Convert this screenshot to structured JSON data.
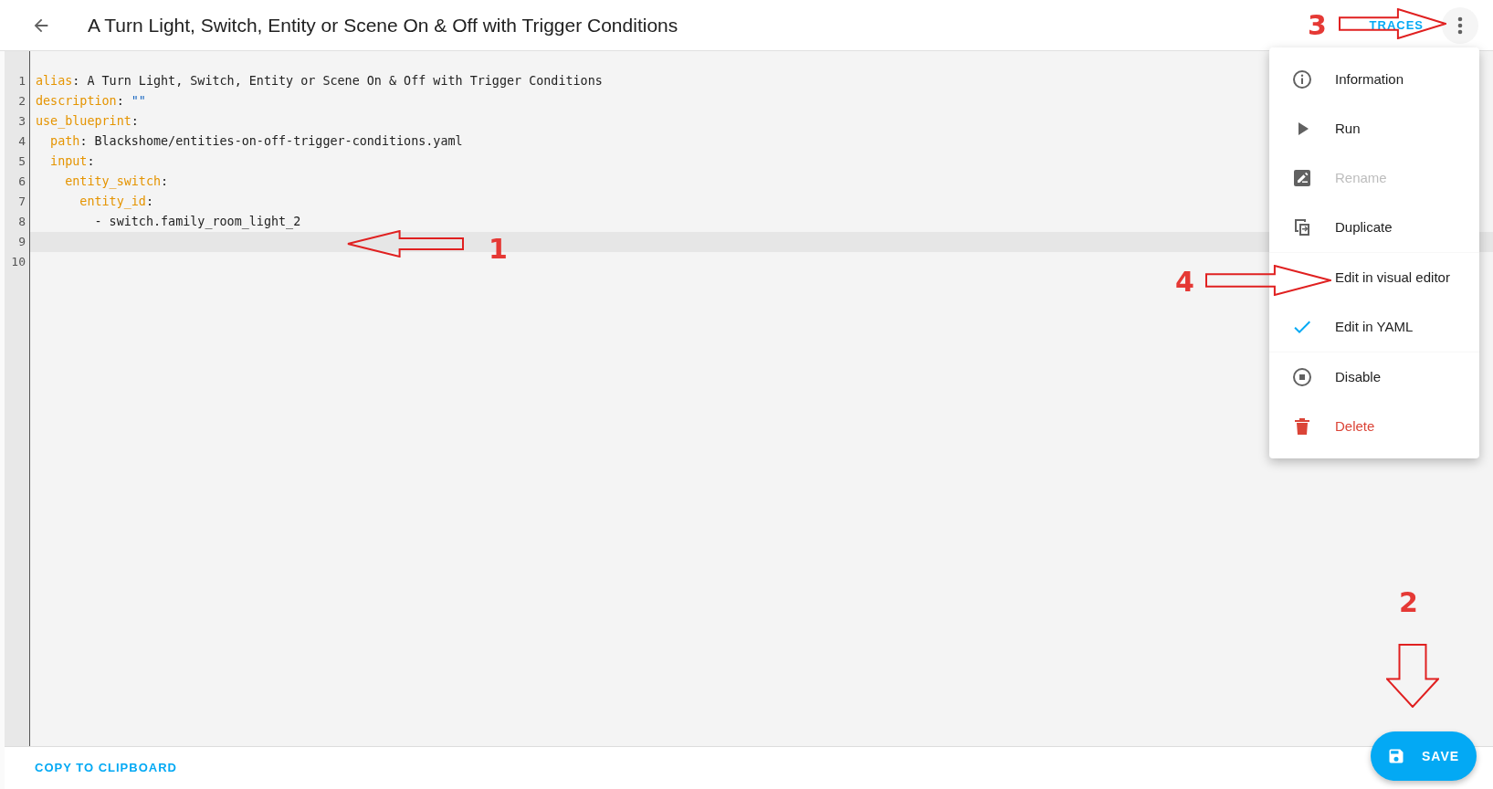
{
  "header": {
    "title": "A Turn Light, Switch, Entity or Scene On & Off with Trigger Conditions",
    "traces_label": "TRACES"
  },
  "editor": {
    "lines": [
      {
        "number": "1",
        "selected": false,
        "segments": [
          {
            "kind": "key",
            "text": "alias"
          },
          {
            "kind": "plain",
            "text": ": A Turn Light, Switch, Entity or Scene On & Off with Trigger Conditions"
          }
        ]
      },
      {
        "number": "2",
        "selected": false,
        "segments": [
          {
            "kind": "key",
            "text": "description"
          },
          {
            "kind": "plain",
            "text": ": "
          },
          {
            "kind": "string",
            "text": "\"\""
          }
        ]
      },
      {
        "number": "3",
        "selected": false,
        "segments": [
          {
            "kind": "key",
            "text": "use_blueprint"
          },
          {
            "kind": "plain",
            "text": ":"
          }
        ]
      },
      {
        "number": "4",
        "selected": false,
        "segments": [
          {
            "kind": "key",
            "text": "  path"
          },
          {
            "kind": "plain",
            "text": ": Blackshome/entities-on-off-trigger-conditions.yaml"
          }
        ]
      },
      {
        "number": "5",
        "selected": false,
        "segments": [
          {
            "kind": "key",
            "text": "  input"
          },
          {
            "kind": "plain",
            "text": ":"
          }
        ]
      },
      {
        "number": "6",
        "selected": false,
        "segments": [
          {
            "kind": "key",
            "text": "    entity_switch"
          },
          {
            "kind": "plain",
            "text": ":"
          }
        ]
      },
      {
        "number": "7",
        "selected": false,
        "segments": [
          {
            "kind": "key",
            "text": "      entity_id"
          },
          {
            "kind": "plain",
            "text": ":"
          }
        ]
      },
      {
        "number": "8",
        "selected": false,
        "segments": [
          {
            "kind": "plain",
            "text": "        - switch.family_room_light_2"
          }
        ]
      },
      {
        "number": "9",
        "selected": true
      },
      {
        "number": "10",
        "selected": false
      }
    ]
  },
  "menu": {
    "items": [
      {
        "label": "Information",
        "kind": "info",
        "disabled": false,
        "checked": false,
        "divider_after": false
      },
      {
        "label": "Run",
        "kind": "run",
        "disabled": false,
        "checked": false,
        "divider_after": false
      },
      {
        "label": "Rename",
        "kind": "rename",
        "disabled": true,
        "checked": false,
        "divider_after": false
      },
      {
        "label": "Duplicate",
        "kind": "duplicate",
        "disabled": false,
        "checked": false,
        "divider_after": true
      },
      {
        "label": "Edit in visual editor",
        "kind": "mode",
        "disabled": false,
        "checked": false,
        "divider_after": false
      },
      {
        "label": "Edit in YAML",
        "kind": "mode",
        "disabled": false,
        "checked": true,
        "divider_after": true
      },
      {
        "label": "Disable",
        "kind": "disable",
        "disabled": false,
        "checked": false,
        "divider_after": false
      },
      {
        "label": "Delete",
        "kind": "delete",
        "disabled": false,
        "checked": false,
        "divider_after": false
      }
    ]
  },
  "footer": {
    "copy_label": "COPY TO CLIPBOARD",
    "save_label": "SAVE"
  },
  "annotations": [
    {
      "number": "1"
    },
    {
      "number": "2"
    },
    {
      "number": "3"
    },
    {
      "number": "4"
    }
  ]
}
